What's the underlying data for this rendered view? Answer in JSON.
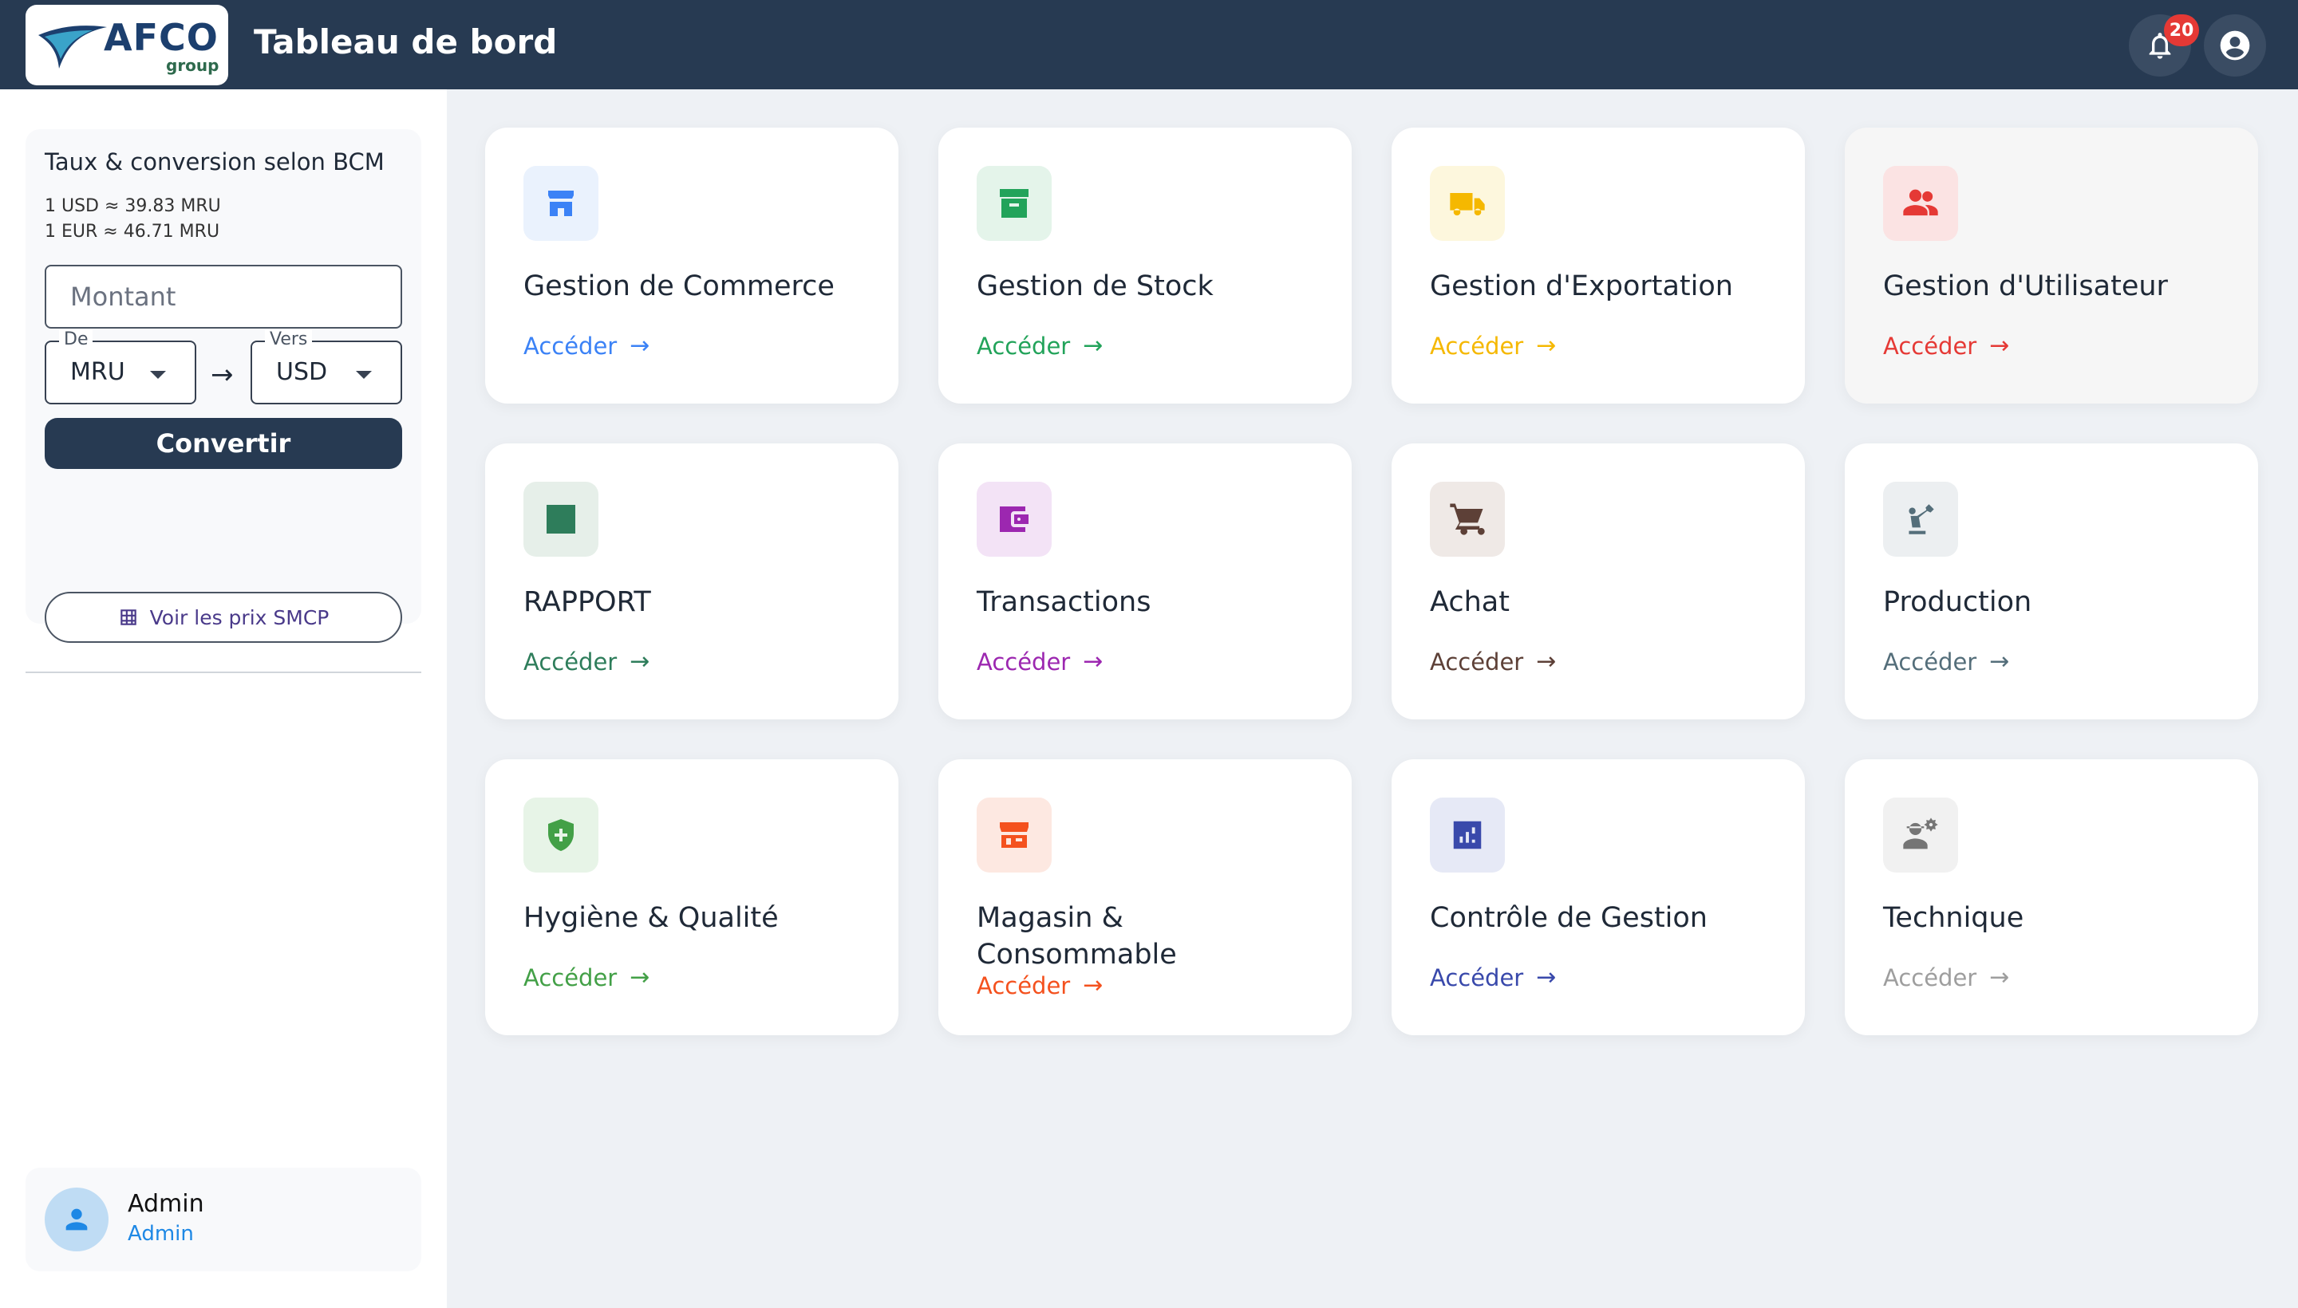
{
  "header": {
    "logo_text": "AFCO",
    "logo_sub": "group",
    "title": "Tableau de bord",
    "notification_count": "20"
  },
  "converter": {
    "title": "Taux & conversion selon BCM",
    "rate_usd": "1 USD ≈ 39.83 MRU",
    "rate_eur": "1 EUR ≈ 46.71 MRU",
    "amount_placeholder": "Montant",
    "from_label": "De",
    "from_value": "MRU",
    "to_label": "Vers",
    "to_value": "USD",
    "convert_label": "Convertir",
    "smcp_label": "Voir les prix SMCP"
  },
  "user": {
    "name": "Admin",
    "role": "Admin"
  },
  "link_label": "Accéder",
  "modules": [
    {
      "title": "Gestion de Commerce",
      "icon": "store-icon",
      "color": "#3b82f6",
      "bg": "#eaf2fd"
    },
    {
      "title": "Gestion de Stock",
      "icon": "archive-icon",
      "color": "#22a35a",
      "bg": "#e4f4ea"
    },
    {
      "title": "Gestion d'Exportation",
      "icon": "truck-icon",
      "color": "#f5b800",
      "bg": "#fdf7dd"
    },
    {
      "title": "Gestion d'Utilisateur",
      "icon": "users-icon",
      "color": "#e53935",
      "bg": "#fbe3e3"
    },
    {
      "title": "RAPPORT",
      "icon": "chart-icon",
      "color": "#2e7d5b",
      "bg": "#e6efe9"
    },
    {
      "title": "Transactions",
      "icon": "wallet-icon",
      "color": "#9c27b0",
      "bg": "#f3e3f6"
    },
    {
      "title": "Achat",
      "icon": "cart-icon",
      "color": "#5d4037",
      "bg": "#efe9e6"
    },
    {
      "title": "Production",
      "icon": "robot-arm-icon",
      "color": "#546e7a",
      "bg": "#eceff1"
    },
    {
      "title": "Hygiène & Qualité",
      "icon": "shield-plus-icon",
      "color": "#43a047",
      "bg": "#e7f4e7"
    },
    {
      "title": "Magasin & Consommable",
      "icon": "storefront-icon",
      "color": "#f4511e",
      "bg": "#fde8e1"
    },
    {
      "title": "Contrôle de Gestion",
      "icon": "analytics-icon",
      "color": "#3949ab",
      "bg": "#e6e9f6"
    },
    {
      "title": "Technique",
      "icon": "engineer-icon",
      "color": "#757575",
      "bg": "#f1f1f1"
    }
  ]
}
